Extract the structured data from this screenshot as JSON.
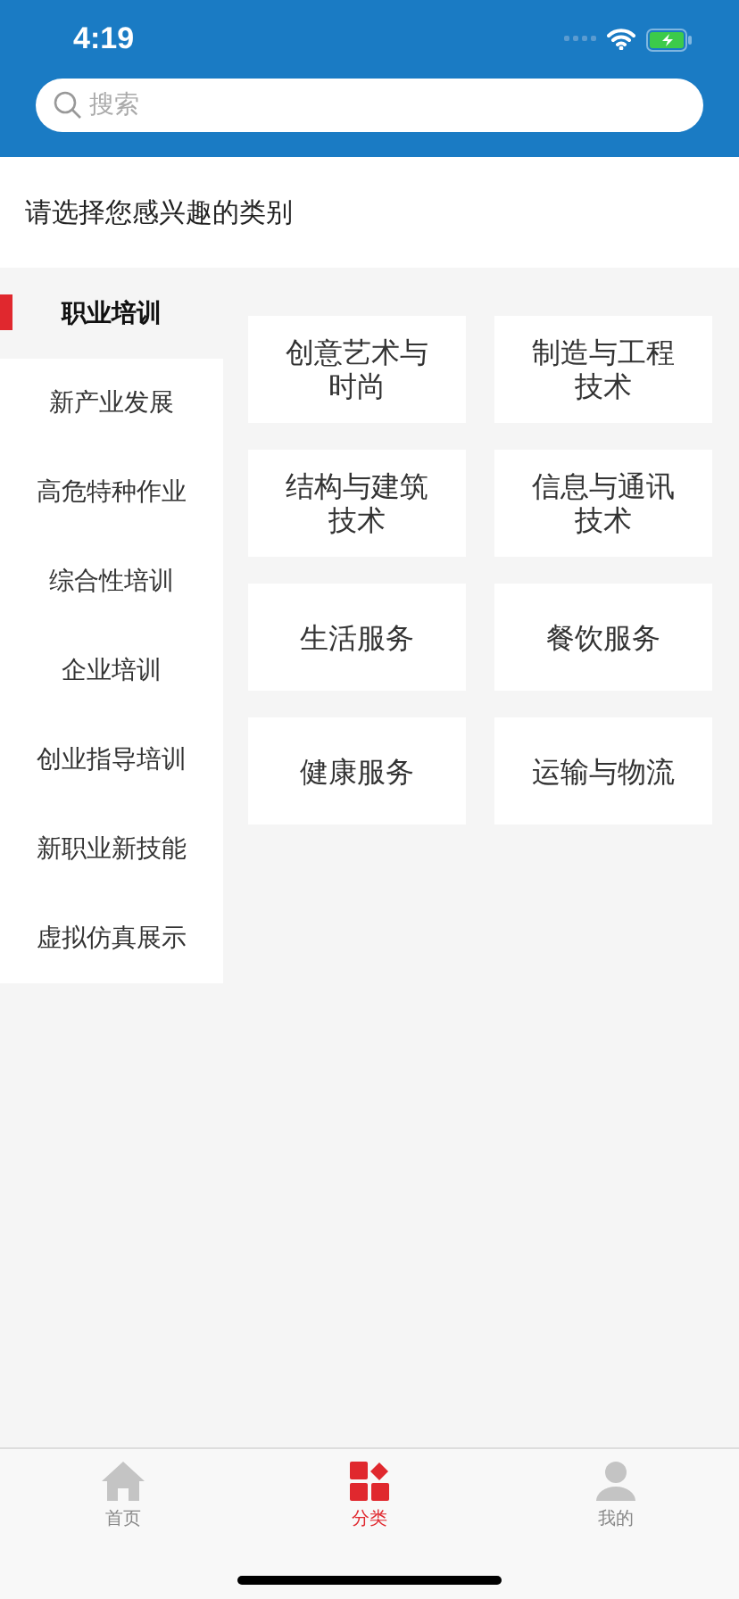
{
  "status_bar": {
    "time": "4:19"
  },
  "search": {
    "placeholder": "搜索"
  },
  "prompt": "请选择您感兴趣的类别",
  "sidebar": {
    "items": [
      {
        "label": "职业培训",
        "selected": true
      },
      {
        "label": "新产业发展",
        "selected": false
      },
      {
        "label": "高危特种作业",
        "selected": false
      },
      {
        "label": "综合性培训",
        "selected": false
      },
      {
        "label": "企业培训",
        "selected": false
      },
      {
        "label": "创业指导培训",
        "selected": false
      },
      {
        "label": "新职业新技能",
        "selected": false
      },
      {
        "label": "虚拟仿真展示",
        "selected": false
      }
    ]
  },
  "categories": [
    {
      "label": "创意艺术与时尚"
    },
    {
      "label": "制造与工程技术"
    },
    {
      "label": "结构与建筑技术"
    },
    {
      "label": "信息与通讯技术"
    },
    {
      "label": "生活服务"
    },
    {
      "label": "餐饮服务"
    },
    {
      "label": "健康服务"
    },
    {
      "label": "运输与物流"
    }
  ],
  "tab_bar": {
    "tabs": [
      {
        "label": "首页",
        "kind": "home",
        "selected": false
      },
      {
        "label": "分类",
        "kind": "category",
        "selected": true
      },
      {
        "label": "我的",
        "kind": "profile",
        "selected": false
      }
    ]
  }
}
